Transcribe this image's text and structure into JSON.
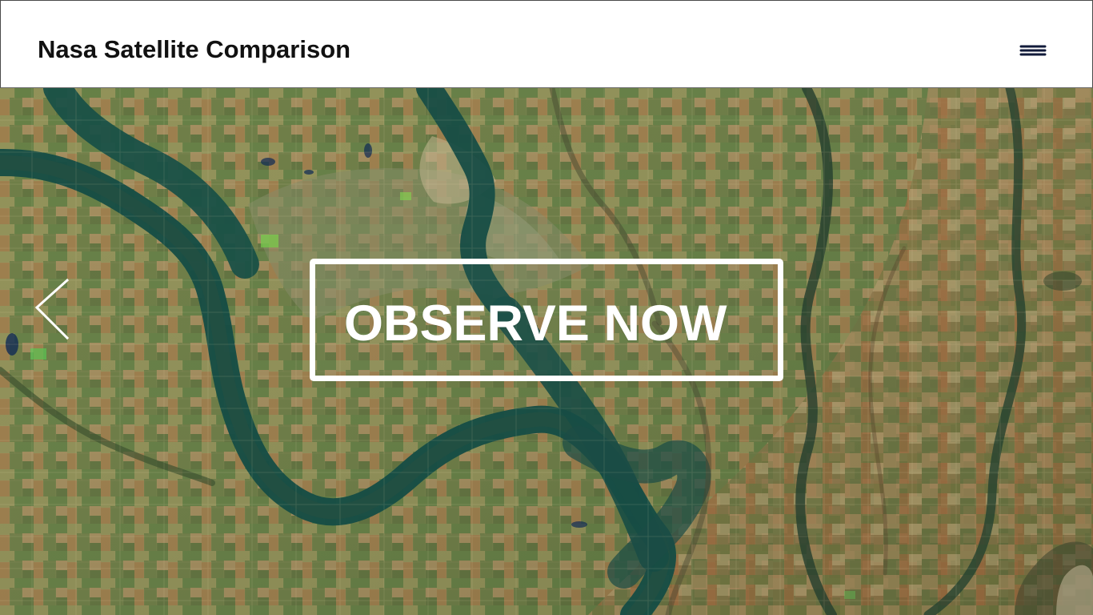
{
  "header": {
    "title": "Nasa Satellite Comparison",
    "menu_icon": "hamburger-menu-icon"
  },
  "hero": {
    "image": "satellite-map-river-farmland",
    "previous_icon": "chevron-left-icon",
    "cta_label": "OBSERVE NOW"
  },
  "colors": {
    "header_background": "#ffffff",
    "header_text": "#111111",
    "menu_icon": "#111a3a",
    "cta_border": "#ffffff",
    "cta_text": "#ffffff",
    "water": "#164d45",
    "farmland_green": "#737c44",
    "farmland_tan": "#9b8650"
  }
}
